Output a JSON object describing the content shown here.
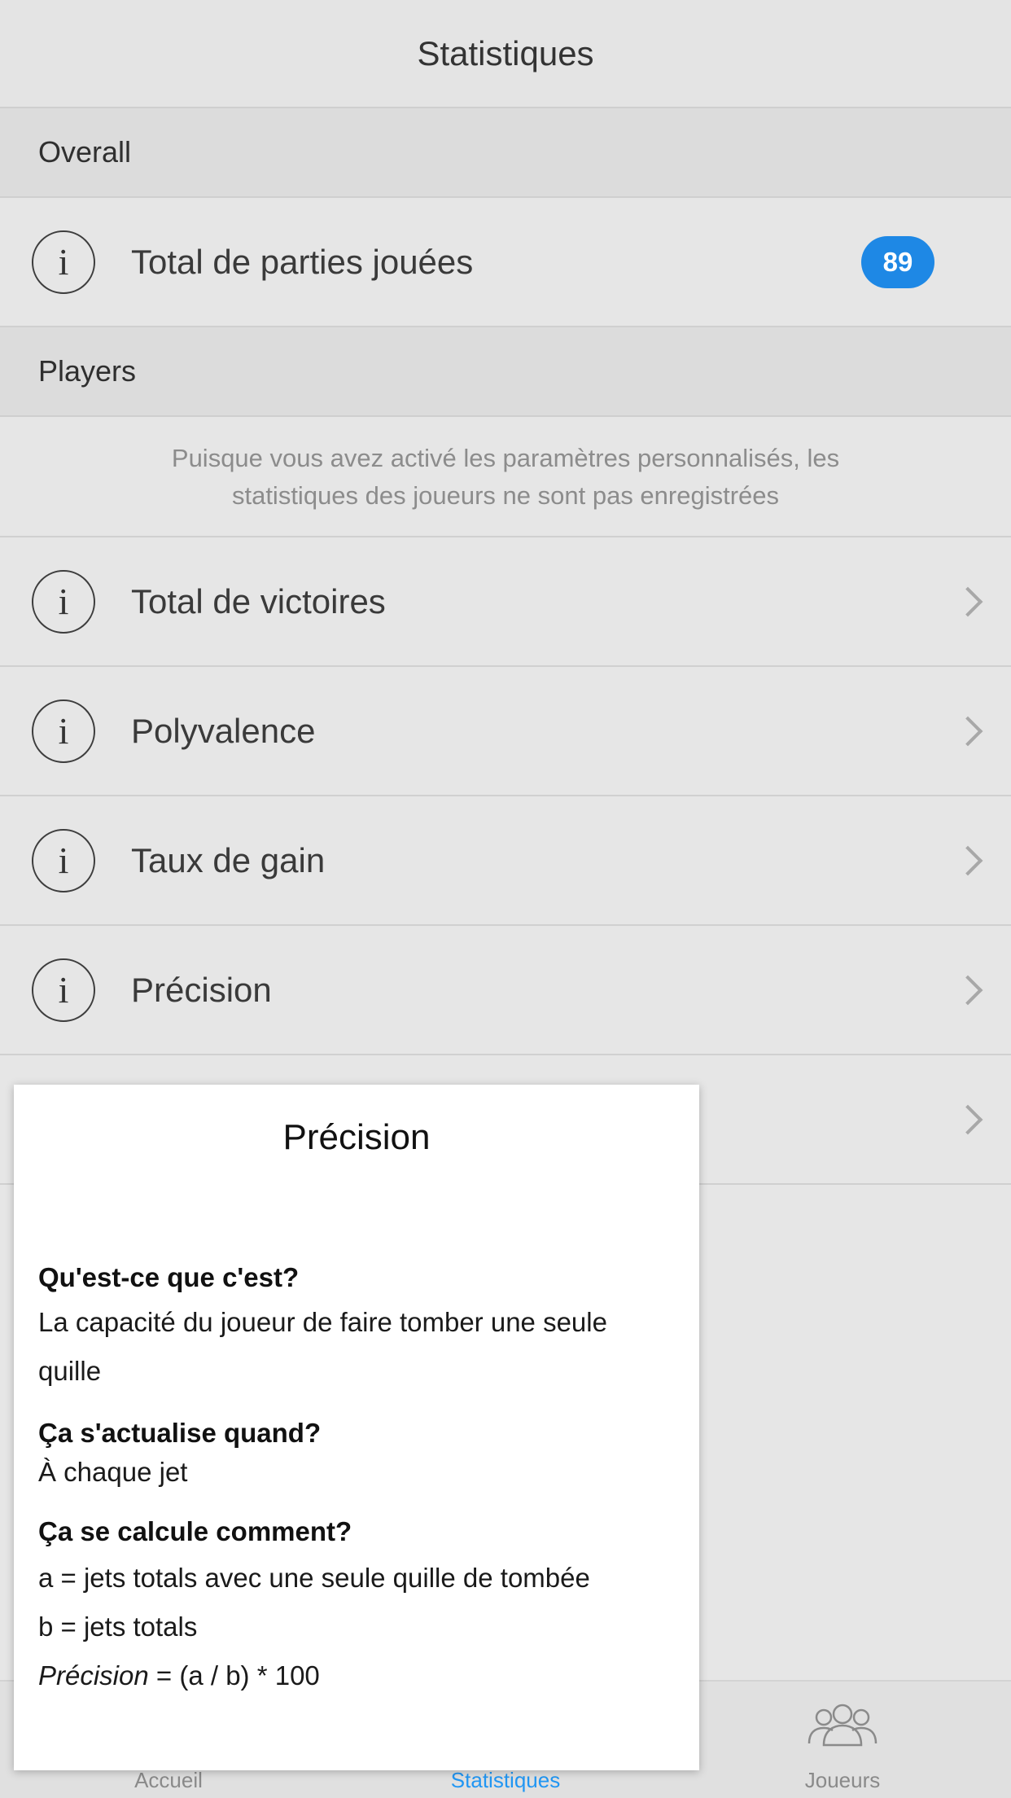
{
  "navbar": {
    "title": "Statistiques"
  },
  "overall": {
    "header": "Overall",
    "total_games": {
      "label": "Total de parties jouées",
      "count": "89"
    }
  },
  "players": {
    "header": "Players",
    "notice": "Puisque vous avez activé les paramètres personnalisés, les statistiques des joueurs ne sont pas enregistrées",
    "rows": [
      {
        "label": "Total de victoires"
      },
      {
        "label": "Polyvalence"
      },
      {
        "label": "Taux de gain"
      },
      {
        "label": "Précision"
      },
      {
        "label": ""
      }
    ]
  },
  "popup": {
    "title": "Précision",
    "q1": "Qu'est-ce que c'est?",
    "a1": "La capacité du joueur de faire tomber une seule quille",
    "q2": "Ça s'actualise quand?",
    "a2": "À chaque jet",
    "q3": "Ça se calcule comment?",
    "a3_line1": "a = jets totals avec une seule quille de tombée",
    "a3_line2": "b = jets totals",
    "a3_formula_term": "Précision",
    "a3_formula_rest": " = (a / b) * 100"
  },
  "tabbar": {
    "tabs": [
      {
        "label": "Accueil"
      },
      {
        "label": "Statistiques"
      },
      {
        "label": "Joueurs"
      }
    ]
  },
  "colors": {
    "accent": "#2196f3",
    "badge": "#1e88e5",
    "background": "#e6e6e6",
    "section_header": "#dcdcdc"
  },
  "icons": [
    "info-icon",
    "chevron-right-icon",
    "players-icon"
  ]
}
